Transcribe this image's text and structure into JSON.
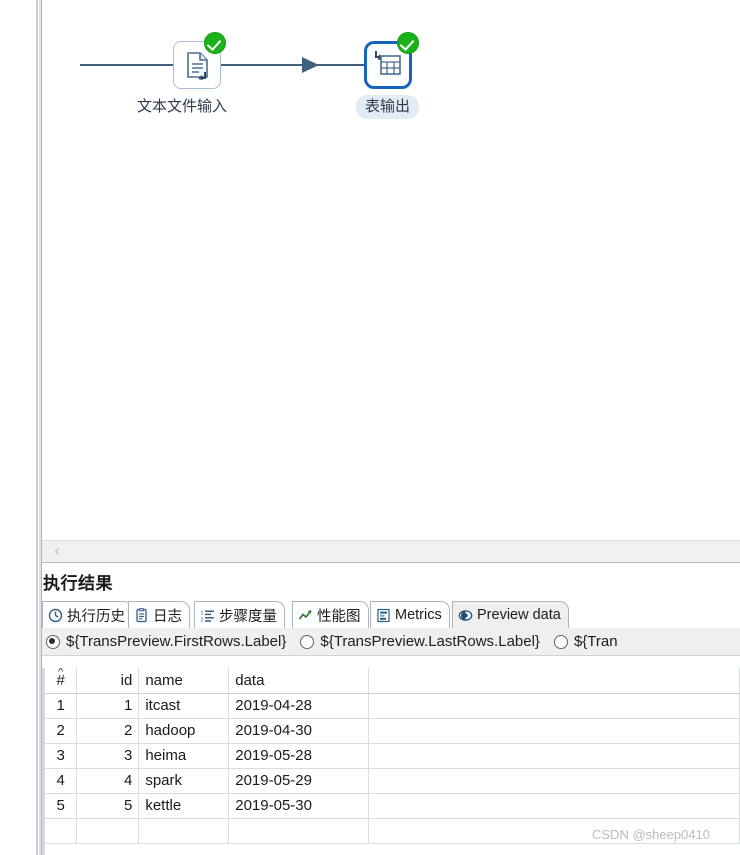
{
  "canvas": {
    "nodes": [
      {
        "id": "text-file-input",
        "label": "文本文件输入",
        "icon": "document-input-icon",
        "status": "ok"
      },
      {
        "id": "table-output",
        "label": "表输出",
        "icon": "table-output-icon",
        "status": "ok",
        "selected": true
      }
    ],
    "hop": {
      "from": "text-file-input",
      "to": "table-output"
    }
  },
  "scrollbar": {
    "left_arrow": "‹"
  },
  "results": {
    "title": "执行结果",
    "tabs": [
      {
        "label": "执行历史",
        "icon": "clock-icon",
        "active": false
      },
      {
        "label": "日志",
        "icon": "log-icon",
        "active": false
      },
      {
        "label": "步骤度量",
        "icon": "list-numbered-icon",
        "active": false
      },
      {
        "label": "性能图",
        "icon": "line-chart-icon",
        "active": false
      },
      {
        "label": "Metrics",
        "icon": "metrics-icon",
        "active": false
      },
      {
        "label": "Preview data",
        "icon": "eye-icon",
        "active": true
      }
    ],
    "radios": [
      {
        "label": "${TransPreview.FirstRows.Label}",
        "selected": true
      },
      {
        "label": "${TransPreview.LastRows.Label}",
        "selected": false
      },
      {
        "label": "${Tran",
        "selected": false
      }
    ],
    "grid": {
      "columns": [
        "#",
        "id",
        "name",
        "data"
      ],
      "sorted_column": "#",
      "rows": [
        {
          "num": "1",
          "id": "1",
          "name": "itcast",
          "data": "2019-04-28"
        },
        {
          "num": "2",
          "id": "2",
          "name": "hadoop",
          "data": "2019-04-30"
        },
        {
          "num": "3",
          "id": "3",
          "name": "heima",
          "data": "2019-05-28"
        },
        {
          "num": "4",
          "id": "4",
          "name": "spark",
          "data": "2019-05-29"
        },
        {
          "num": "5",
          "id": "5",
          "name": "kettle",
          "data": "2019-05-30"
        },
        {
          "num": "",
          "id": "",
          "name": "",
          "data": ""
        }
      ]
    }
  },
  "watermark": "CSDN @sheep0410"
}
